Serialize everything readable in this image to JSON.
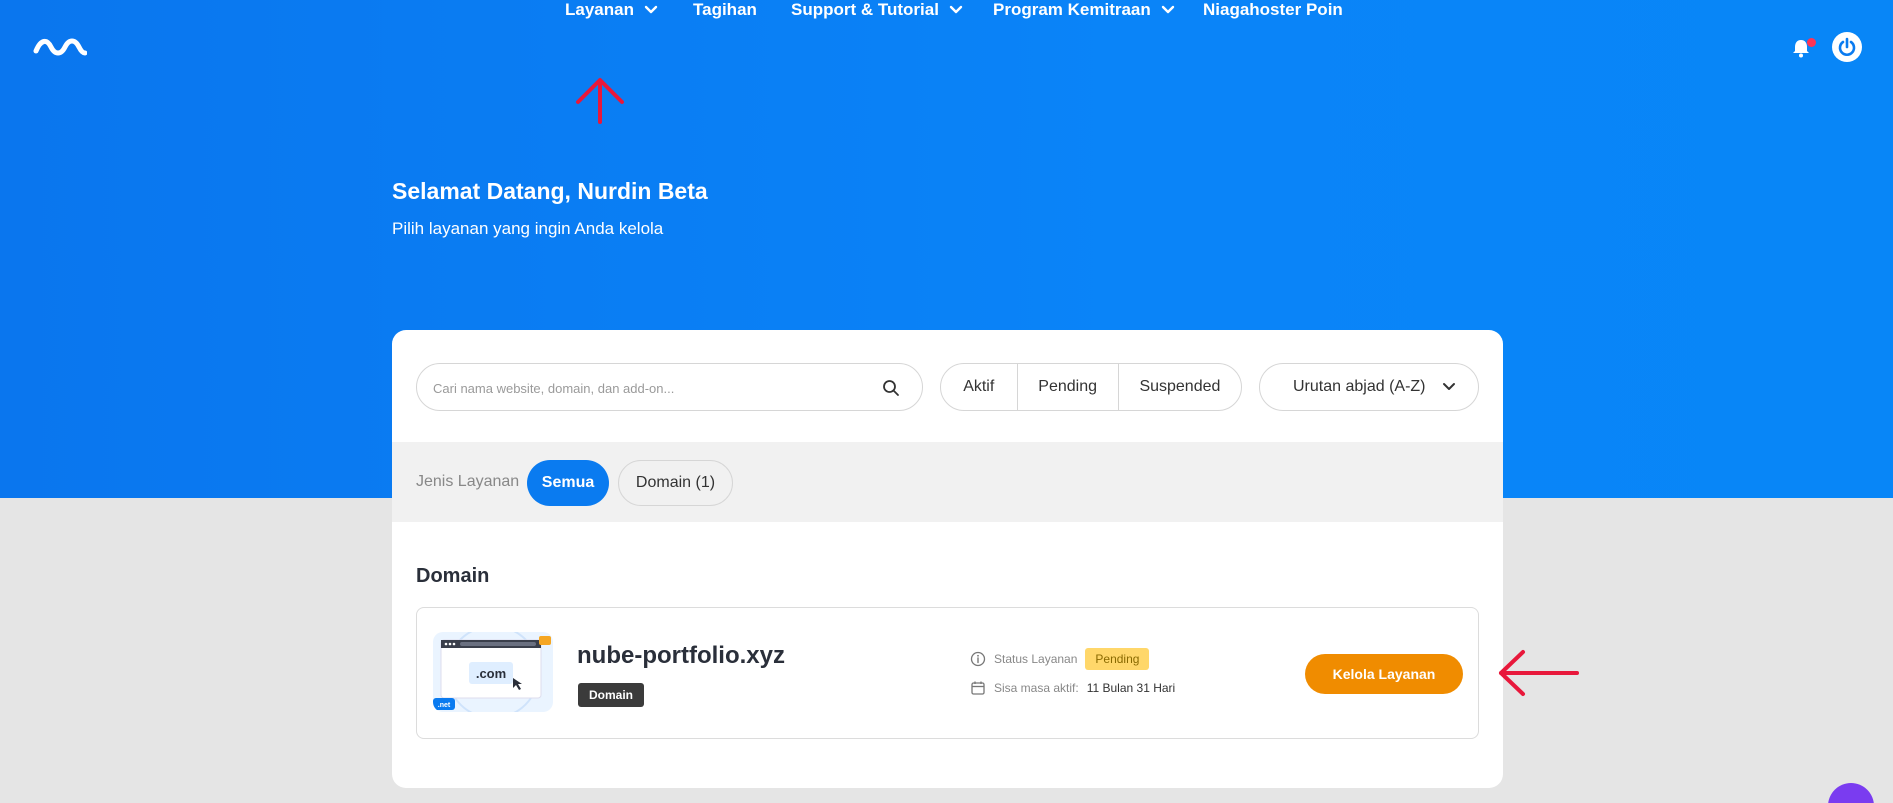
{
  "colors": {
    "hero_blue": "#0a7bf0",
    "accent_blue": "#0a7bf0",
    "orange": "#f08c00",
    "pending_yellow": "#ffd76a",
    "annotation_red": "#e8183b"
  },
  "icons": {
    "logo": "niagahoster-logo",
    "notification": "bell-icon",
    "account": "power-icon",
    "search": "search-icon",
    "chevron": "chevron-down-icon",
    "status": "info-circle-icon",
    "calendar": "calendar-icon",
    "annotation_up": "red-arrow-up",
    "annotation_left": "red-arrow-left",
    "chat": "chat-bubble-icon"
  },
  "nav": {
    "layanan": "Layanan",
    "tagihan": "Tagihan",
    "support": "Support & Tutorial",
    "program": "Program Kemitraan",
    "poin": "Niagahoster Poin"
  },
  "welcome": {
    "title": "Selamat Datang, Nurdin Beta",
    "subtitle": "Pilih layanan yang ingin Anda kelola"
  },
  "search": {
    "placeholder": "Cari nama website, domain, dan add-on..."
  },
  "status_filters": [
    "Aktif",
    "Pending",
    "Suspended"
  ],
  "sort": {
    "label": "Urutan abjad (A-Z)"
  },
  "jenis": {
    "label": "Jenis Layanan",
    "all": "Semua",
    "domain": "Domain (1)"
  },
  "section": {
    "title": "Domain"
  },
  "service": {
    "name": "nube-portfolio.xyz",
    "tag": "Domain",
    "status_label": "Status Layanan",
    "status_value": "Pending",
    "expiry_label": "Sisa masa aktif:",
    "expiry_value": "11 Bulan 31 Hari",
    "action": "Kelola Layanan",
    "thumb_com": ".com",
    "thumb_net": ".net"
  }
}
